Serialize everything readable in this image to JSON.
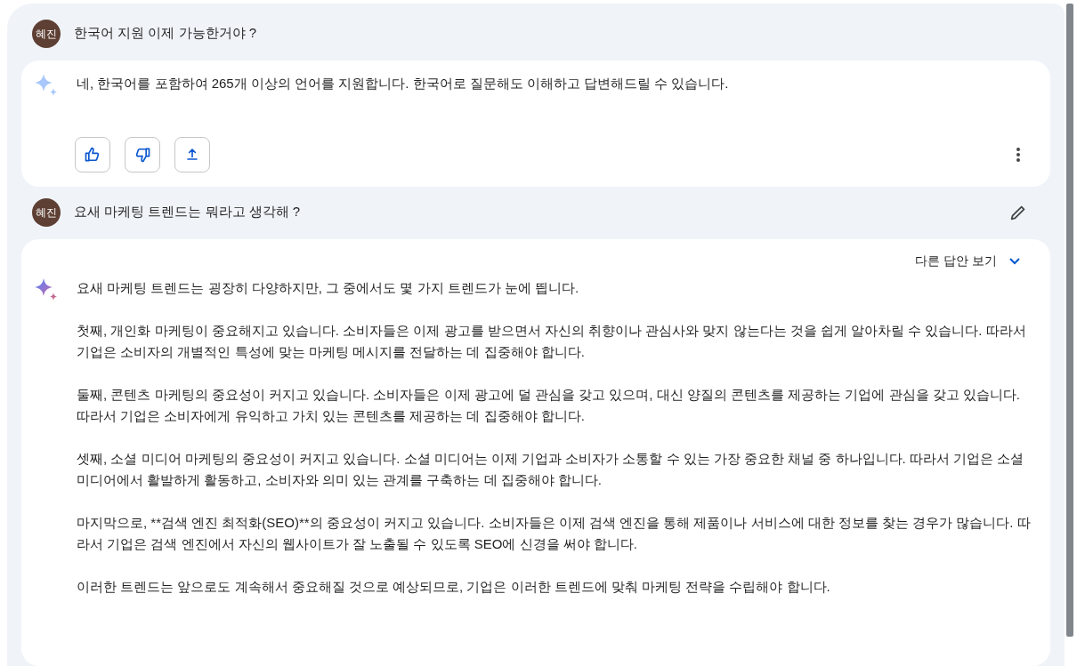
{
  "conversation": [
    {
      "kind": "prompt",
      "avatar": "혜진",
      "text": "한국어 지원 이제 가능한거야 ?",
      "editable": false
    },
    {
      "kind": "response",
      "active": false,
      "paragraphs": [
        "네, 한국어를 포함하여 265개 이상의 언어를 지원합니다. 한국어로 질문해도 이해하고 답변해드릴 수 있습니다."
      ],
      "actions": true
    },
    {
      "kind": "prompt",
      "avatar": "혜진",
      "text": "요새 마케팅 트렌드는 뭐라고 생각해 ?",
      "editable": true
    },
    {
      "kind": "response",
      "active": true,
      "drafts_label": "다른 답안 보기",
      "paragraphs": [
        "요새 마케팅 트렌드는 굉장히 다양하지만, 그 중에서도 몇 가지 트렌드가 눈에 띕니다.",
        "첫째, 개인화 마케팅이 중요해지고 있습니다. 소비자들은 이제 광고를 받으면서 자신의 취향이나 관심사와 맞지 않는다는 것을 쉽게 알아차릴 수 있습니다. 따라서 기업은 소비자의 개별적인 특성에 맞는 마케팅 메시지를 전달하는 데 집중해야 합니다.",
        "둘째, 콘텐츠 마케팅의 중요성이 커지고 있습니다. 소비자들은 이제 광고에 덜 관심을 갖고 있으며, 대신 양질의 콘텐츠를 제공하는 기업에 관심을 갖고 있습니다. 따라서 기업은 소비자에게 유익하고 가치 있는 콘텐츠를 제공하는 데 집중해야 합니다.",
        "셋째, 소셜 미디어 마케팅의 중요성이 커지고 있습니다. 소셜 미디어는 이제 기업과 소비자가 소통할 수 있는 가장 중요한 채널 중 하나입니다. 따라서 기업은 소셜 미디어에서 활발하게 활동하고, 소비자와 의미 있는 관계를 구축하는 데 집중해야 합니다.",
        "마지막으로, **검색 엔진 최적화(SEO)**의 중요성이 커지고 있습니다. 소비자들은 이제 검색 엔진을 통해 제품이나 서비스에 대한 정보를 찾는 경우가 많습니다. 따라서 기업은 검색 엔진에서 자신의 웹사이트가 잘 노출될 수 있도록 SEO에 신경을 써야 합니다.",
        "이러한 트렌드는 앞으로도 계속해서 중요해질 것으로 예상되므로, 기업은 이러한 트렌드에 맞춰 마케팅 전략을 수립해야 합니다."
      ],
      "actions": false
    }
  ]
}
